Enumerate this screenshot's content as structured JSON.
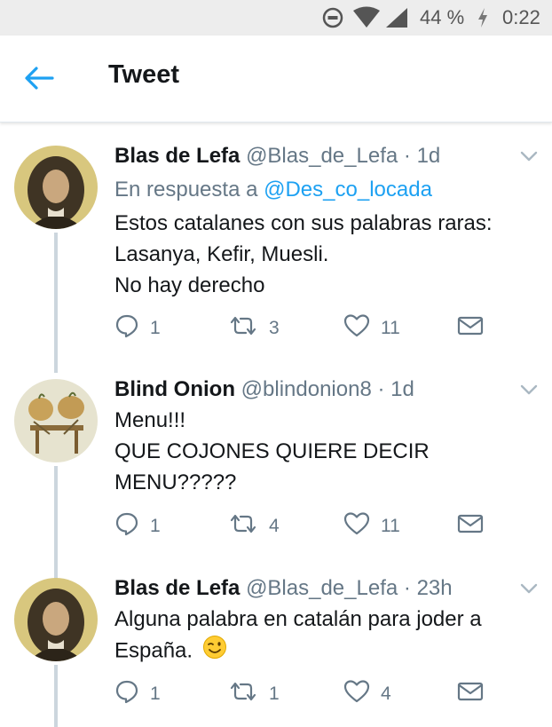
{
  "status_bar": {
    "battery": "44 %",
    "time": "0:22"
  },
  "app_bar": {
    "title": "Tweet"
  },
  "tweets": [
    {
      "name": "Blas de Lefa",
      "handle": "@Blas_de_Lefa",
      "separator": "·",
      "time": "1d",
      "reply_prefix": "En respuesta a",
      "reply_mention": "@Des_co_locada",
      "lines": [
        "Estos catalanes con sus palabras raras:",
        "Lasanya, Kefir, Muesli.",
        "No hay derecho"
      ],
      "replies": "1",
      "retweets": "3",
      "likes": "11"
    },
    {
      "name": "Blind Onion",
      "handle": "@blindonion8",
      "separator": "·",
      "time": "1d",
      "lines": [
        "Menu!!!",
        "QUE COJONES QUIERE DECIR",
        "MENU?????"
      ],
      "replies": "1",
      "retweets": "4",
      "likes": "11"
    },
    {
      "name": "Blas de Lefa",
      "handle": "@Blas_de_Lefa",
      "separator": "·",
      "time": "23h",
      "lines": [
        "Alguna palabra en catalán para joder a",
        "España."
      ],
      "emoji": "wink-emoji",
      "replies": "1",
      "retweets": "1",
      "likes": "4"
    }
  ],
  "icons": {
    "back": "arrow-left-icon",
    "reply": "reply-bubble-icon",
    "retweet": "retweet-icon",
    "like": "heart-icon",
    "dm": "envelope-icon",
    "caret": "chevron-down-icon"
  },
  "colors": {
    "accent": "#1da1f2",
    "muted": "#657786",
    "text": "#14171a",
    "thread_line": "#ccd6dd"
  }
}
